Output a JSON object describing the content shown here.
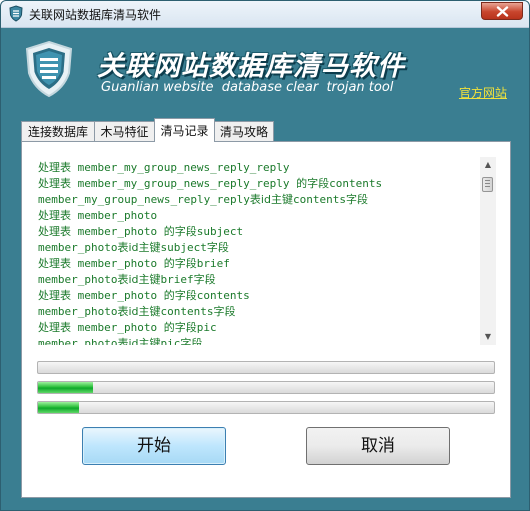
{
  "window": {
    "title": "关联网站数据库清马软件",
    "close_label": "close"
  },
  "banner": {
    "title": "关联网站数据库清马软件",
    "subtitle": "Guanlian website  database clear  trojan tool",
    "official_link": "官方网站"
  },
  "tabs": [
    {
      "label": "连接数据库",
      "active": false
    },
    {
      "label": "木马特征",
      "active": false
    },
    {
      "label": "清马记录",
      "active": true
    },
    {
      "label": "清马攻略",
      "active": false
    }
  ],
  "log": {
    "lines": [
      {
        "prefix": "处理表",
        "text": " member_my_group_news_reply_reply",
        "suffix": "",
        "tail": ""
      },
      {
        "prefix": "处理表",
        "text": " member_my_group_news_reply_reply ",
        "suffix": "的字段",
        "tail": "contents"
      },
      {
        "prefix": "",
        "text": "member_my_group_news_reply_reply",
        "suffix": "表id主键",
        "tail": "contents字段"
      },
      {
        "prefix": "处理表",
        "text": " member_photo",
        "suffix": "",
        "tail": ""
      },
      {
        "prefix": "处理表",
        "text": " member_photo ",
        "suffix": "的字段",
        "tail": "subject"
      },
      {
        "prefix": "",
        "text": "member_photo",
        "suffix": "表id主键",
        "tail": "subject字段"
      },
      {
        "prefix": "处理表",
        "text": " member_photo ",
        "suffix": "的字段",
        "tail": "brief"
      },
      {
        "prefix": "",
        "text": "member_photo",
        "suffix": "表id主键",
        "tail": "brief字段"
      },
      {
        "prefix": "处理表",
        "text": " member_photo ",
        "suffix": "的字段",
        "tail": "contents"
      },
      {
        "prefix": "",
        "text": "member_photo",
        "suffix": "表id主键",
        "tail": "contents字段"
      },
      {
        "prefix": "处理表",
        "text": " member_photo ",
        "suffix": "的字段",
        "tail": "pic"
      },
      {
        "prefix": "",
        "text": "member_photo",
        "suffix": "表id主键",
        "tail": "pic字段"
      }
    ]
  },
  "progress": [
    {
      "name": "progress-bar-1",
      "fraction": 0.0
    },
    {
      "name": "progress-bar-2",
      "fraction": 0.12
    },
    {
      "name": "progress-bar-3",
      "fraction": 0.09
    }
  ],
  "buttons": {
    "start": "开始",
    "cancel": "取消"
  },
  "colors": {
    "background": "#3a7e91",
    "log_text": "#1b7a2b",
    "link": "#f2e23a",
    "progress_fill": "#1db534"
  },
  "icons": {
    "app": "shield-icon",
    "close": "close-icon",
    "scroll_up": "arrow-up-icon",
    "scroll_down": "arrow-down-icon"
  }
}
